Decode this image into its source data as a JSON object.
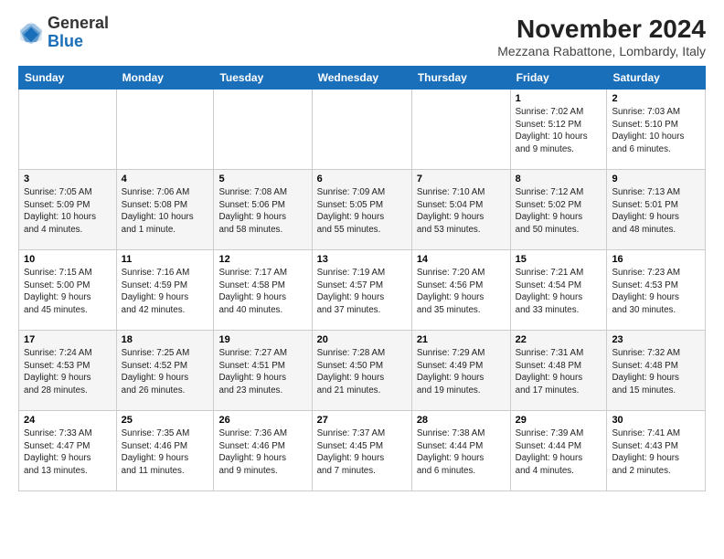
{
  "header": {
    "logo": {
      "line1": "General",
      "line2": "Blue"
    },
    "title": "November 2024",
    "location": "Mezzana Rabattone, Lombardy, Italy"
  },
  "calendar": {
    "headers": [
      "Sunday",
      "Monday",
      "Tuesday",
      "Wednesday",
      "Thursday",
      "Friday",
      "Saturday"
    ],
    "weeks": [
      [
        {
          "day": "",
          "info": ""
        },
        {
          "day": "",
          "info": ""
        },
        {
          "day": "",
          "info": ""
        },
        {
          "day": "",
          "info": ""
        },
        {
          "day": "",
          "info": ""
        },
        {
          "day": "1",
          "info": "Sunrise: 7:02 AM\nSunset: 5:12 PM\nDaylight: 10 hours\nand 9 minutes."
        },
        {
          "day": "2",
          "info": "Sunrise: 7:03 AM\nSunset: 5:10 PM\nDaylight: 10 hours\nand 6 minutes."
        }
      ],
      [
        {
          "day": "3",
          "info": "Sunrise: 7:05 AM\nSunset: 5:09 PM\nDaylight: 10 hours\nand 4 minutes."
        },
        {
          "day": "4",
          "info": "Sunrise: 7:06 AM\nSunset: 5:08 PM\nDaylight: 10 hours\nand 1 minute."
        },
        {
          "day": "5",
          "info": "Sunrise: 7:08 AM\nSunset: 5:06 PM\nDaylight: 9 hours\nand 58 minutes."
        },
        {
          "day": "6",
          "info": "Sunrise: 7:09 AM\nSunset: 5:05 PM\nDaylight: 9 hours\nand 55 minutes."
        },
        {
          "day": "7",
          "info": "Sunrise: 7:10 AM\nSunset: 5:04 PM\nDaylight: 9 hours\nand 53 minutes."
        },
        {
          "day": "8",
          "info": "Sunrise: 7:12 AM\nSunset: 5:02 PM\nDaylight: 9 hours\nand 50 minutes."
        },
        {
          "day": "9",
          "info": "Sunrise: 7:13 AM\nSunset: 5:01 PM\nDaylight: 9 hours\nand 48 minutes."
        }
      ],
      [
        {
          "day": "10",
          "info": "Sunrise: 7:15 AM\nSunset: 5:00 PM\nDaylight: 9 hours\nand 45 minutes."
        },
        {
          "day": "11",
          "info": "Sunrise: 7:16 AM\nSunset: 4:59 PM\nDaylight: 9 hours\nand 42 minutes."
        },
        {
          "day": "12",
          "info": "Sunrise: 7:17 AM\nSunset: 4:58 PM\nDaylight: 9 hours\nand 40 minutes."
        },
        {
          "day": "13",
          "info": "Sunrise: 7:19 AM\nSunset: 4:57 PM\nDaylight: 9 hours\nand 37 minutes."
        },
        {
          "day": "14",
          "info": "Sunrise: 7:20 AM\nSunset: 4:56 PM\nDaylight: 9 hours\nand 35 minutes."
        },
        {
          "day": "15",
          "info": "Sunrise: 7:21 AM\nSunset: 4:54 PM\nDaylight: 9 hours\nand 33 minutes."
        },
        {
          "day": "16",
          "info": "Sunrise: 7:23 AM\nSunset: 4:53 PM\nDaylight: 9 hours\nand 30 minutes."
        }
      ],
      [
        {
          "day": "17",
          "info": "Sunrise: 7:24 AM\nSunset: 4:53 PM\nDaylight: 9 hours\nand 28 minutes."
        },
        {
          "day": "18",
          "info": "Sunrise: 7:25 AM\nSunset: 4:52 PM\nDaylight: 9 hours\nand 26 minutes."
        },
        {
          "day": "19",
          "info": "Sunrise: 7:27 AM\nSunset: 4:51 PM\nDaylight: 9 hours\nand 23 minutes."
        },
        {
          "day": "20",
          "info": "Sunrise: 7:28 AM\nSunset: 4:50 PM\nDaylight: 9 hours\nand 21 minutes."
        },
        {
          "day": "21",
          "info": "Sunrise: 7:29 AM\nSunset: 4:49 PM\nDaylight: 9 hours\nand 19 minutes."
        },
        {
          "day": "22",
          "info": "Sunrise: 7:31 AM\nSunset: 4:48 PM\nDaylight: 9 hours\nand 17 minutes."
        },
        {
          "day": "23",
          "info": "Sunrise: 7:32 AM\nSunset: 4:48 PM\nDaylight: 9 hours\nand 15 minutes."
        }
      ],
      [
        {
          "day": "24",
          "info": "Sunrise: 7:33 AM\nSunset: 4:47 PM\nDaylight: 9 hours\nand 13 minutes."
        },
        {
          "day": "25",
          "info": "Sunrise: 7:35 AM\nSunset: 4:46 PM\nDaylight: 9 hours\nand 11 minutes."
        },
        {
          "day": "26",
          "info": "Sunrise: 7:36 AM\nSunset: 4:46 PM\nDaylight: 9 hours\nand 9 minutes."
        },
        {
          "day": "27",
          "info": "Sunrise: 7:37 AM\nSunset: 4:45 PM\nDaylight: 9 hours\nand 7 minutes."
        },
        {
          "day": "28",
          "info": "Sunrise: 7:38 AM\nSunset: 4:44 PM\nDaylight: 9 hours\nand 6 minutes."
        },
        {
          "day": "29",
          "info": "Sunrise: 7:39 AM\nSunset: 4:44 PM\nDaylight: 9 hours\nand 4 minutes."
        },
        {
          "day": "30",
          "info": "Sunrise: 7:41 AM\nSunset: 4:43 PM\nDaylight: 9 hours\nand 2 minutes."
        }
      ]
    ]
  }
}
